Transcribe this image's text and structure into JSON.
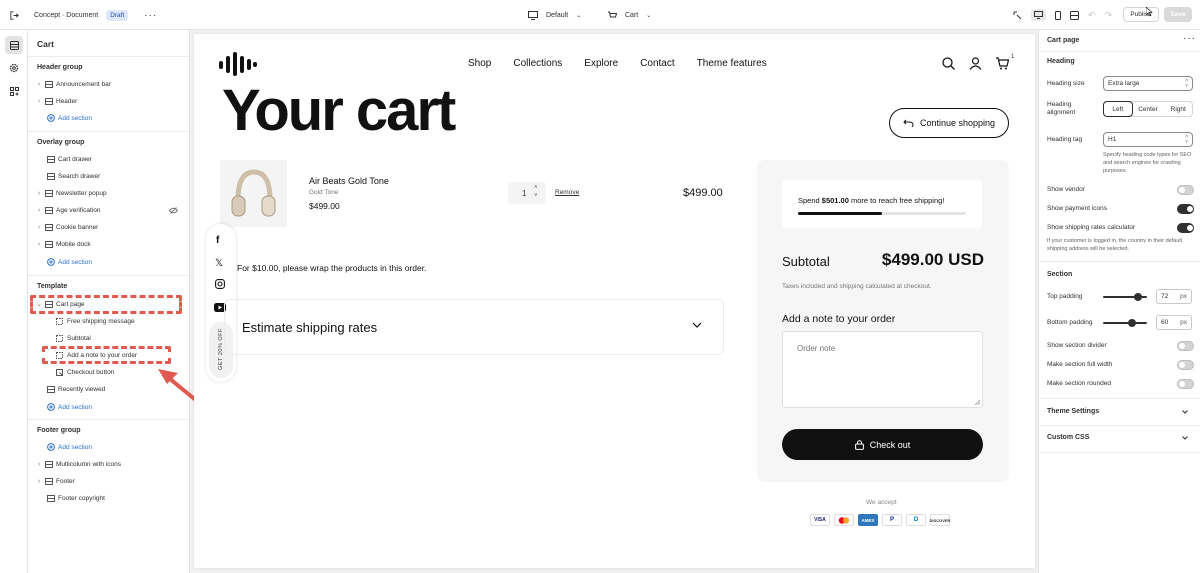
{
  "topbar": {
    "breadcrumb": "Concept · Document",
    "status_badge": "Draft",
    "theme_select": "Default",
    "page_select": "Cart",
    "publish_label": "Publish",
    "save_label": "Save"
  },
  "left_panel": {
    "title": "Cart",
    "header_group": {
      "label": "Header group",
      "items": [
        "Announcement bar",
        "Header"
      ],
      "add_label": "Add section"
    },
    "overlay_group": {
      "label": "Overlay group",
      "items": [
        "Cart drawer",
        "Search drawer",
        "Newsletter popup",
        "Age verification",
        "Cookie banner",
        "Mobile dock"
      ],
      "add_label": "Add section"
    },
    "template": {
      "label": "Template",
      "section": "Cart page",
      "blocks": [
        "Free shipping message",
        "Subtotal",
        "Add a note to your order",
        "Checkout button"
      ],
      "recently_viewed": "Recently viewed",
      "add_label": "Add section"
    },
    "footer_group": {
      "label": "Footer group",
      "add_label": "Add section",
      "items": [
        "Multicolumn with icons",
        "Footer",
        "Footer copyright"
      ]
    }
  },
  "preview": {
    "nav": [
      "Shop",
      "Collections",
      "Explore",
      "Contact",
      "Theme features"
    ],
    "cart_count": "1",
    "heading": "Your cart",
    "continue_label": "Continue shopping",
    "product": {
      "name": "Air Beats Gold Tone",
      "variant": "Gold Tone",
      "price": "$499.00",
      "quantity": "1",
      "remove_label": "Remove",
      "line_total": "$499.00"
    },
    "wrap_note": "For $10.00, please wrap the products in this order.",
    "estimate_label": "Estimate shipping rates",
    "side_tab": "GET 20% OFF",
    "shipping": {
      "pre": "Spend ",
      "amount": "$501.00",
      "post": " more to reach free shipping!",
      "progress": 0.5
    },
    "subtotal_label": "Subtotal",
    "subtotal_value": "$499.00 USD",
    "tax_note": "Taxes included and shipping calculated at checkout.",
    "note_title": "Add a note to your order",
    "note_placeholder": "Order note",
    "checkout_label": "Check out",
    "we_accept": "We accept",
    "payments": [
      "VISA",
      "mastercard",
      "AMEX",
      "P",
      "D",
      "DISCOVER"
    ]
  },
  "right_panel": {
    "title": "Cart page",
    "heading_section": "Heading",
    "heading_size_label": "Heading size",
    "heading_size_value": "Extra large",
    "heading_alignment_label": "Heading alignment",
    "alignment_options": [
      "Left",
      "Center",
      "Right"
    ],
    "heading_tag_label": "Heading tag",
    "heading_tag_value": "H1",
    "heading_tag_help": "Specify heading code types for SEO and search engines for crawling purposes.",
    "show_vendor": "Show vendor",
    "show_payment_icons": "Show payment icons",
    "show_shipping_calc": "Show shipping rates calculator",
    "shipping_calc_help": "If your customer is logged in, the country in their default shipping address will be selected.",
    "section_label": "Section",
    "top_padding_label": "Top padding",
    "top_padding_value": "72",
    "bottom_padding_label": "Bottom padding",
    "bottom_padding_value": "60",
    "padding_unit": "px",
    "top_padding_fraction": 0.8,
    "bottom_padding_fraction": 0.67,
    "show_divider": "Show section divider",
    "full_width": "Make section full width",
    "rounded": "Make section rounded",
    "theme_settings": "Theme Settings",
    "custom_css": "Custom CSS"
  },
  "colors": {
    "accent_blue": "#2c6ecb",
    "annotation_red": "#e05a4f",
    "dark": "#1a1a1a"
  }
}
